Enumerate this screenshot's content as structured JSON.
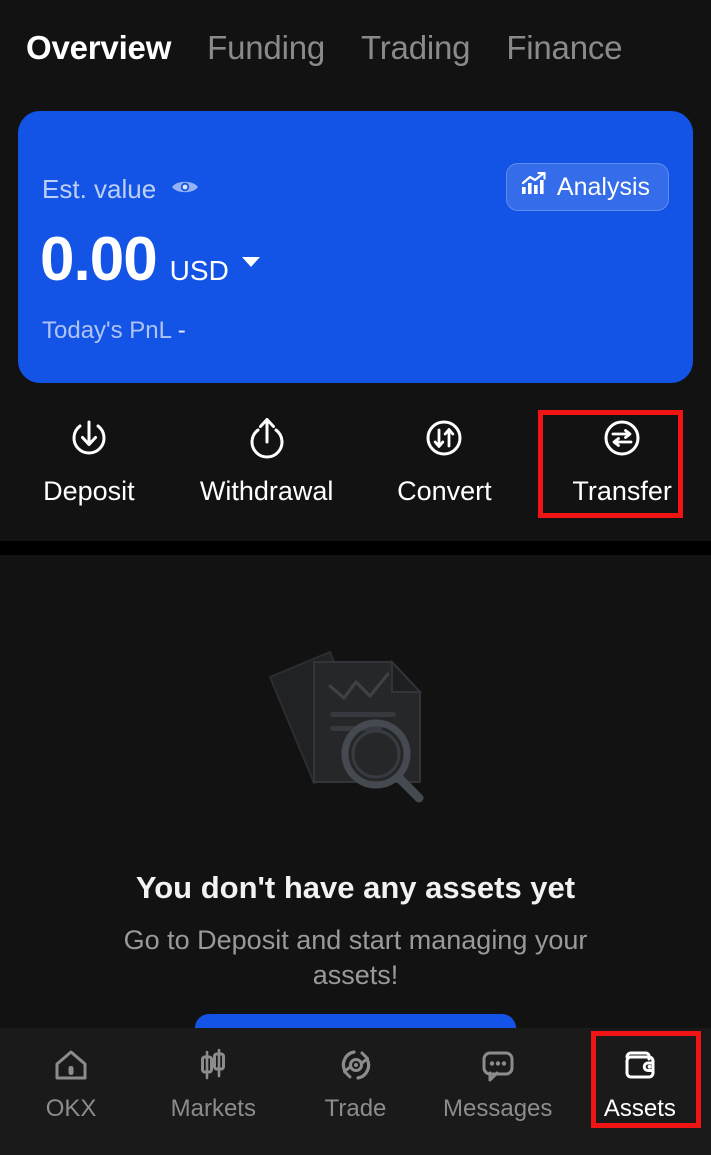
{
  "app": {
    "name": "OKX",
    "accent_blue": "#1354e6",
    "highlight_red": "#f01414",
    "background": "#121212"
  },
  "tabs": [
    {
      "label": "Overview",
      "active": true
    },
    {
      "label": "Funding",
      "active": false
    },
    {
      "label": "Trading",
      "active": false
    },
    {
      "label": "Finance",
      "active": false
    }
  ],
  "balance_card": {
    "est_value_label": "Est. value",
    "visibility_icon": "eye-icon",
    "amount": "0.00",
    "currency": "USD",
    "currency_caret_icon": "chevron-down-icon",
    "pnl_label": "Today's PnL",
    "pnl_value": "-",
    "analysis_button": {
      "label": "Analysis",
      "icon": "chart-trend-icon"
    }
  },
  "quick_actions": [
    {
      "label": "Deposit",
      "icon": "deposit-arrow-down-icon",
      "highlighted": false
    },
    {
      "label": "Withdrawal",
      "icon": "withdrawal-arrow-up-icon",
      "highlighted": false
    },
    {
      "label": "Convert",
      "icon": "convert-arrows-icon",
      "highlighted": false
    },
    {
      "label": "Transfer",
      "icon": "transfer-arrows-icon",
      "highlighted": true
    }
  ],
  "empty_state": {
    "illustration_icon": "documents-magnifier-icon",
    "title": "You don't have any assets yet",
    "subtitle": "Go to Deposit and start managing your assets!",
    "cta_visible": true
  },
  "bottom_nav": [
    {
      "label": "OKX",
      "icon": "home-icon",
      "active": false
    },
    {
      "label": "Markets",
      "icon": "candlestick-icon",
      "active": false
    },
    {
      "label": "Trade",
      "icon": "trade-refresh-icon",
      "active": false
    },
    {
      "label": "Messages",
      "icon": "chat-bubble-icon",
      "active": false
    },
    {
      "label": "Assets",
      "icon": "wallet-icon",
      "active": true
    }
  ]
}
